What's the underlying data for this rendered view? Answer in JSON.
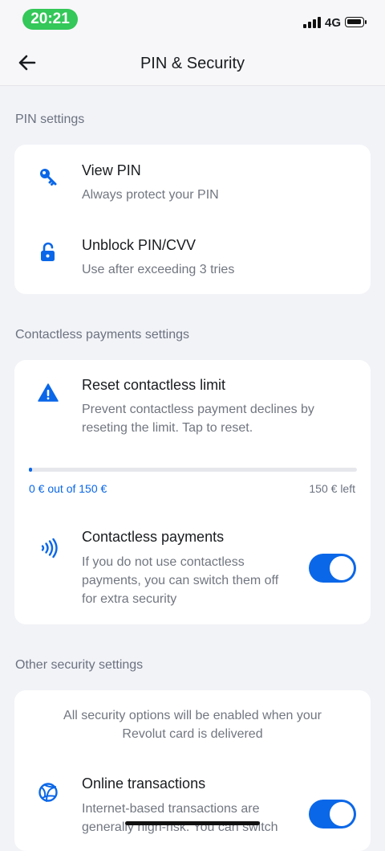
{
  "status_bar": {
    "time": "20:21",
    "network": "4G"
  },
  "header": {
    "title": "PIN & Security"
  },
  "pin_settings": {
    "header": "PIN settings",
    "items": [
      {
        "icon": "key-icon",
        "title": "View PIN",
        "subtitle": "Always protect your PIN"
      },
      {
        "icon": "unlock-icon",
        "title": "Unblock PIN/CVV",
        "subtitle": "Use after exceeding 3 tries"
      }
    ]
  },
  "contactless": {
    "header": "Contactless payments settings",
    "reset": {
      "icon": "warning-icon",
      "title": "Reset contactless limit",
      "subtitle_line1": "Prevent contactless payment declines by",
      "subtitle_line2": "reseting the limit. Tap to reset."
    },
    "limit": {
      "used_label": "0 € out of 150 €",
      "left_label": "150 € left",
      "used_fraction": 0
    },
    "payments": {
      "icon": "contactless-icon",
      "title": "Contactless payments",
      "subtitle_line1": "If you do not use contactless",
      "subtitle_line2": "payments, you can switch them off",
      "subtitle_line3": "for extra security",
      "enabled": true
    }
  },
  "other_security": {
    "header": "Other security settings",
    "notice_line1": "All security options will be enabled when your",
    "notice_line2": "Revolut card is delivered",
    "online": {
      "icon": "globe-icon",
      "title": "Online transactions",
      "subtitle_line1": "Internet-based transactions are",
      "subtitle_line2": "generally high-risk. You can switch",
      "enabled": true
    }
  },
  "colors": {
    "accent": "#0a67e8",
    "background": "#f2f3f7",
    "card": "#ffffff",
    "status_pill": "#34c759"
  }
}
